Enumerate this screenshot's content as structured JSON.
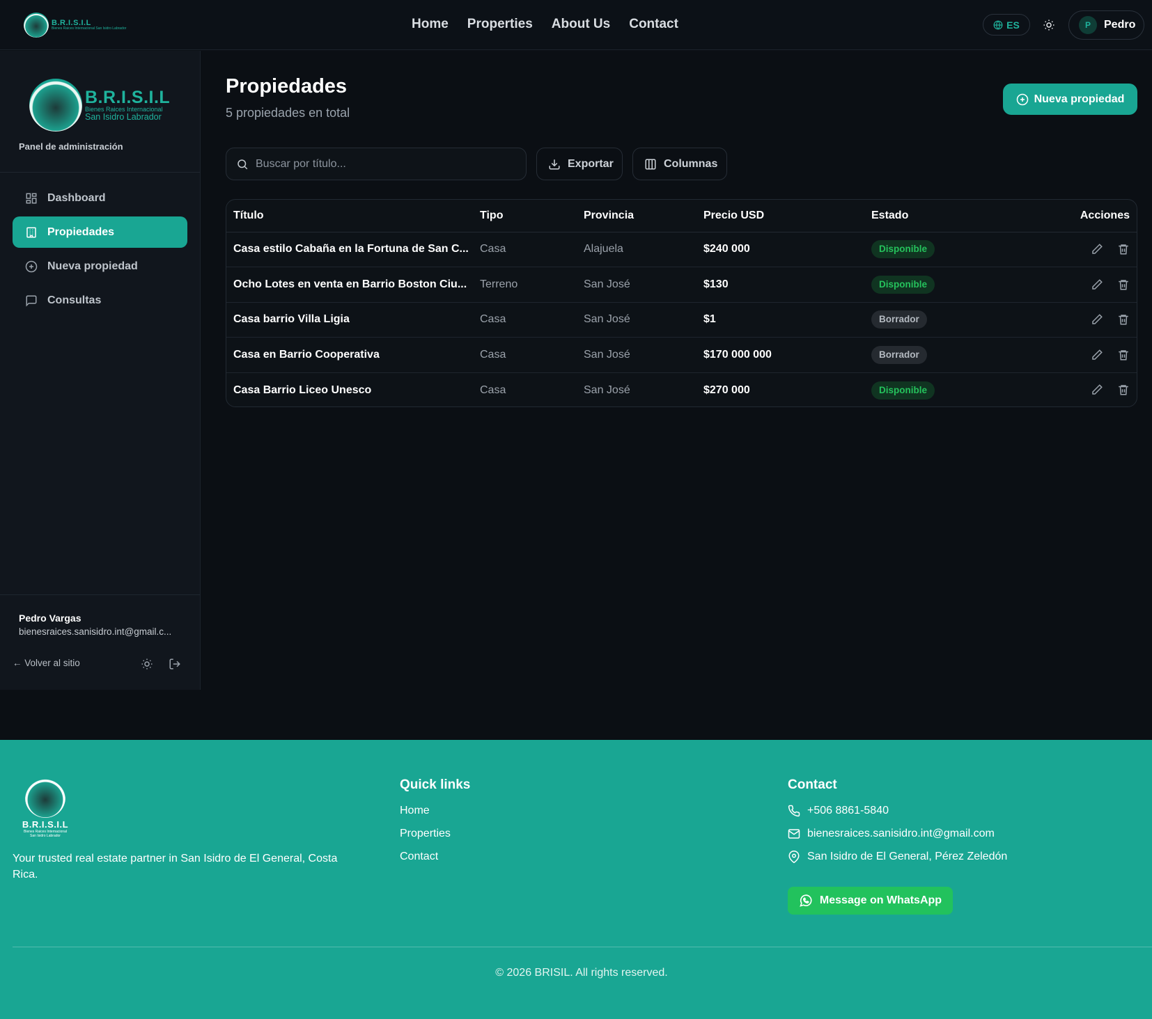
{
  "header": {
    "logo_text": "B.R.I.S.I.L",
    "logo_subtext": "Bienes Raices Internacional San Isidro Labrador",
    "nav": [
      "Home",
      "Properties",
      "About Us",
      "Contact"
    ],
    "lang": "ES",
    "user_initial": "P",
    "user_name": "Pedro"
  },
  "sidebar": {
    "brand": "B.R.I.S.I.L",
    "brand_sub1": "Bienes Raices Internacional",
    "brand_sub2": "San Isidro Labrador",
    "panel_label": "Panel de administración",
    "items": [
      {
        "label": "Dashboard",
        "icon": "dashboard-icon"
      },
      {
        "label": "Propiedades",
        "icon": "building-icon",
        "active": true
      },
      {
        "label": "Nueva propiedad",
        "icon": "plus-circle-icon"
      },
      {
        "label": "Consultas",
        "icon": "message-icon"
      }
    ],
    "user_name": "Pedro Vargas",
    "user_email": "bienesraices.sanisidro.int@gmail.c...",
    "back_label": "← Volver al sitio"
  },
  "main": {
    "title": "Propiedades",
    "subtitle": "5 propiedades en total",
    "new_button": "Nueva propiedad",
    "search_placeholder": "Buscar por título...",
    "export_label": "Exportar",
    "columns_label": "Columnas",
    "table": {
      "headers": [
        "Título",
        "Tipo",
        "Provincia",
        "Precio USD",
        "Estado",
        "Acciones"
      ],
      "rows": [
        {
          "title": "Casa estilo Cabaña en la Fortuna de San C...",
          "tipo": "Casa",
          "provincia": "Alajuela",
          "precio": "$240 000",
          "estado": "Disponible"
        },
        {
          "title": "Ocho Lotes en venta en Barrio Boston Ciu...",
          "tipo": "Terreno",
          "provincia": "San José",
          "precio": "$130",
          "estado": "Disponible"
        },
        {
          "title": "Casa barrio Villa Ligia",
          "tipo": "Casa",
          "provincia": "San José",
          "precio": "$1",
          "estado": "Borrador"
        },
        {
          "title": "Casa en Barrio Cooperativa",
          "tipo": "Casa",
          "provincia": "San José",
          "precio": "$170 000 000",
          "estado": "Borrador"
        },
        {
          "title": "Casa Barrio Liceo Unesco",
          "tipo": "Casa",
          "provincia": "San José",
          "precio": "$270 000",
          "estado": "Disponible"
        }
      ]
    }
  },
  "footer": {
    "logo_text": "B.R.I.S.I.L",
    "logo_subtext": "Bienes Raices Internacional San Isidro Labrador",
    "tagline": "Your trusted real estate partner in San Isidro de El General, Costa Rica.",
    "quick_links_title": "Quick links",
    "quick_links": [
      "Home",
      "Properties",
      "Contact"
    ],
    "contact_title": "Contact",
    "phone": "+506 8861-5840",
    "email": "bienesraices.sanisidro.int@gmail.com",
    "address": "San Isidro de El General, Pérez Zeledón",
    "whatsapp_label": "Message on WhatsApp",
    "copyright": "© 2026 BRISIL. All rights reserved."
  },
  "colors": {
    "accent": "#19a693",
    "background": "#0b0f14",
    "available": "#25c25c",
    "whatsapp": "#22c25d"
  }
}
